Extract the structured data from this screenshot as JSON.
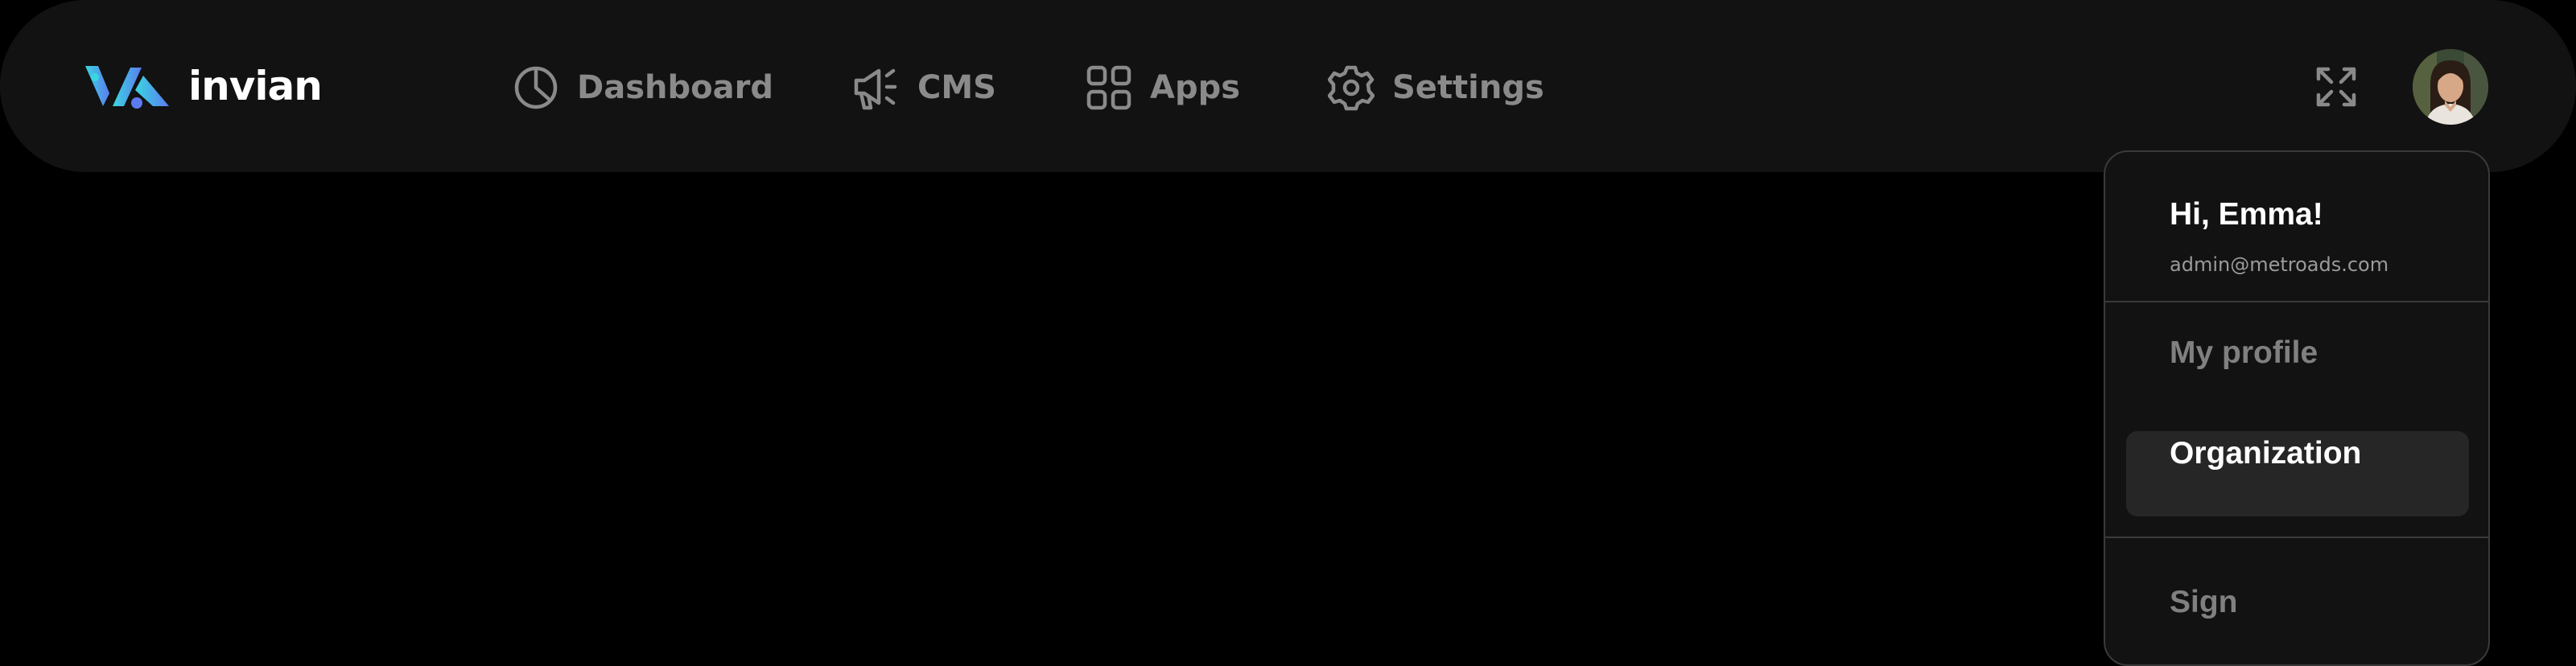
{
  "brand": {
    "name": "invian",
    "logo_icon": "invian-logo-icon",
    "colors": {
      "gradient_start": "#3ad6e0",
      "gradient_end": "#5b7cf0"
    }
  },
  "nav": {
    "items": [
      {
        "label": "Dashboard",
        "icon": "pie-chart-icon"
      },
      {
        "label": "CMS",
        "icon": "megaphone-icon"
      },
      {
        "label": "Apps",
        "icon": "apps-grid-icon"
      },
      {
        "label": "Settings",
        "icon": "gear-icon"
      }
    ]
  },
  "header_actions": {
    "fullscreen_icon": "expand-icon",
    "avatar_icon": "user-avatar"
  },
  "user_menu": {
    "greeting": "Hi, Emma!",
    "email": "admin@metroads.com",
    "items": [
      {
        "label": "My profile"
      },
      {
        "label": "Organization",
        "active": true
      },
      {
        "label": "Sign"
      }
    ]
  },
  "theme": {
    "background": "#000000",
    "bar": "#121212",
    "nav_text": "#8a8a8a",
    "active_item_bg": "#262626"
  }
}
